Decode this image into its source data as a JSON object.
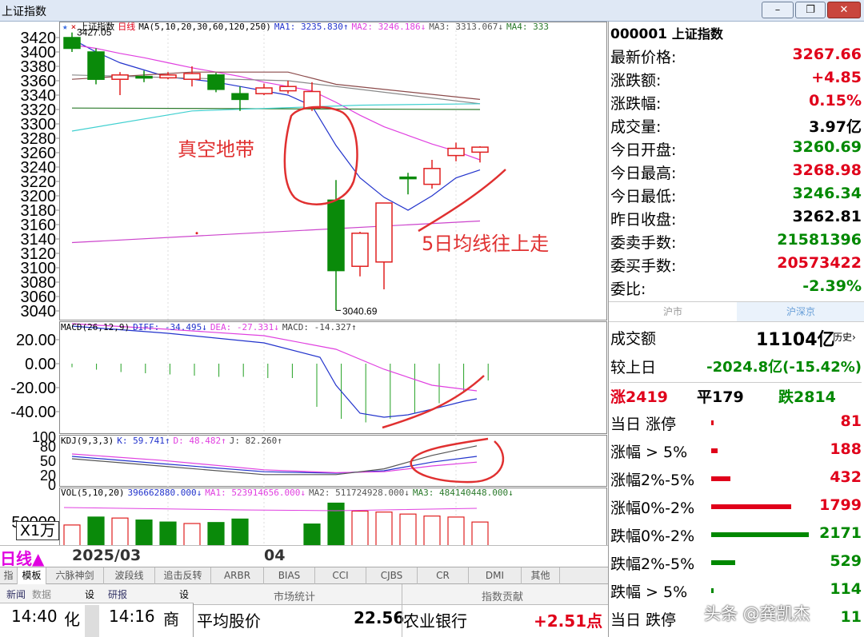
{
  "window": {
    "title": "上证指数",
    "buttons": [
      "–",
      "❐",
      "✕"
    ]
  },
  "chart": {
    "legend_main": {
      "name": "上证指数",
      "period": "日线",
      "ma_params": "MA(5,10,20,30,60,120,250)",
      "ma1": "MA1: 3235.830↑",
      "ma2": "MA2: 3246.186↓",
      "ma3": "MA3: 3313.067↓",
      "ma4": "MA4: 333"
    },
    "high_label": "3427.05",
    "low_label": "3040.69",
    "price_ticks": [
      "3420",
      "3400",
      "3380",
      "3360",
      "3340",
      "3320",
      "3300",
      "3280",
      "3260",
      "3240",
      "3220",
      "3200",
      "3180",
      "3160",
      "3140",
      "3120",
      "3100",
      "3080",
      "3060",
      "3040"
    ],
    "annotation_vacuum": "真空地带",
    "annotation_ma5": "5日均线往上走",
    "macd_legend": {
      "name": "MACD(26,12,9)",
      "diff": "DIFF: -34.495↓",
      "dea": "DEA: -27.331↓",
      "macd": "MACD: -14.327↑"
    },
    "macd_ticks": [
      "20.00",
      "0.00",
      "-20.00",
      "-40.00"
    ],
    "kdj_legend": {
      "name": "KDJ(9,3,3)",
      "k": "K: 59.741↑",
      "d": "D: 48.482↑",
      "j": "J: 82.260↑"
    },
    "kdj_ticks": [
      "100",
      "80",
      "50",
      "20",
      "0"
    ],
    "vol_legend": {
      "name": "VOL(5,10,20)",
      "vol": "396662880.000↓",
      "ma1": "MA1: 523914656.000↓",
      "ma2": "MA2: 511724928.000↓",
      "ma3": "MA3: 484140448.000↓"
    },
    "vol_tick": "50000",
    "vol_unit": "X1万",
    "period_label": "日线▲",
    "date_label_1": "2025/03",
    "date_label_2": "04"
  },
  "chart_data": {
    "type": "candlestick",
    "candles": [
      {
        "o": 3405,
        "c": 3420,
        "h": 3427.05,
        "l": 3400,
        "up": false
      },
      {
        "o": 3400,
        "c": 3362,
        "h": 3405,
        "l": 3355,
        "up": false
      },
      {
        "o": 3362,
        "c": 3368,
        "h": 3372,
        "l": 3340,
        "up": true
      },
      {
        "o": 3366,
        "c": 3366,
        "h": 3374,
        "l": 3358,
        "up": false
      },
      {
        "o": 3364,
        "c": 3368,
        "h": 3372,
        "l": 3362,
        "up": true
      },
      {
        "o": 3362,
        "c": 3370,
        "h": 3380,
        "l": 3352,
        "up": true
      },
      {
        "o": 3368,
        "c": 3348,
        "h": 3371,
        "l": 3344,
        "up": false
      },
      {
        "o": 3342,
        "c": 3334,
        "h": 3352,
        "l": 3318,
        "up": false
      },
      {
        "o": 3342,
        "c": 3350,
        "h": 3356,
        "l": 3340,
        "up": true
      },
      {
        "o": 3346,
        "c": 3352,
        "h": 3360,
        "l": 3342,
        "up": true
      },
      {
        "o": 3322,
        "c": 3345,
        "h": 3358,
        "l": 3318,
        "up": true
      },
      {
        "o": 3194,
        "c": 3096,
        "h": 3222,
        "l": 3040.69,
        "up": false
      },
      {
        "o": 3102,
        "c": 3148,
        "h": 3150,
        "l": 3088,
        "up": true
      },
      {
        "o": 3108,
        "c": 3190,
        "h": 3190,
        "l": 3070,
        "up": true
      },
      {
        "o": 3226,
        "c": 3224,
        "h": 3232,
        "l": 3202,
        "up": false
      },
      {
        "o": 3216,
        "c": 3238,
        "h": 3250,
        "l": 3210,
        "up": true
      },
      {
        "o": 3256,
        "c": 3266,
        "h": 3274,
        "l": 3248,
        "up": true
      },
      {
        "o": 3260.69,
        "c": 3267.66,
        "h": 3268.98,
        "l": 3246.34,
        "up": true
      }
    ],
    "macd_hist": [
      -3,
      -5,
      -7,
      -8,
      -9,
      -10,
      -11,
      -11,
      -12,
      -12,
      -36,
      -46,
      -49,
      -46,
      -41,
      -33,
      -24,
      -14
    ],
    "volume": [
      42000,
      58000,
      56000,
      52000,
      48000,
      45000,
      47000,
      54000,
      0,
      0,
      44000,
      86000,
      70000,
      68000,
      64000,
      60000,
      58000,
      48000
    ],
    "volume_up": [
      true,
      false,
      true,
      false,
      false,
      true,
      false,
      false,
      true,
      true,
      false,
      false,
      true,
      true,
      true,
      true,
      true,
      true
    ]
  },
  "quote": {
    "code": "000001",
    "name": "上证指数",
    "rows": [
      {
        "label": "最新价格:",
        "value": "3267.66",
        "color": "#e0001a"
      },
      {
        "label": "涨跌额:",
        "value": "+4.85",
        "color": "#e0001a"
      },
      {
        "label": "涨跌幅:",
        "value": "0.15%",
        "color": "#e0001a"
      },
      {
        "label": "成交量:",
        "value": "3.97亿",
        "color": "#000000"
      },
      {
        "label": "今日开盘:",
        "value": "3260.69",
        "color": "#008800"
      },
      {
        "label": "今日最高:",
        "value": "3268.98",
        "color": "#e0001a"
      },
      {
        "label": "今日最低:",
        "value": "3246.34",
        "color": "#008800"
      },
      {
        "label": "昨日收盘:",
        "value": "3262.81",
        "color": "#000000"
      },
      {
        "label": "委卖手数:",
        "value": "21581396",
        "color": "#008800"
      },
      {
        "label": "委买手数:",
        "value": "20573422",
        "color": "#e0001a"
      },
      {
        "label": "委比:",
        "value": "-2.39%",
        "color": "#008800"
      }
    ]
  },
  "market_tabs": [
    "沪市",
    "沪深京"
  ],
  "market": {
    "turnover_label": "成交额",
    "turnover_value": "11104亿",
    "history_link": "历史›",
    "compare_label": "较上日",
    "compare_value": "-2024.8亿(-15.42%)",
    "up_label": "涨",
    "up_count": "2419",
    "flat_label": "平",
    "flat_count": "179",
    "down_label": "跌",
    "down_count": "2814",
    "rows": [
      {
        "label": "当日 涨停",
        "value": "81",
        "color": "#e0001a",
        "bar": 3
      },
      {
        "label": "涨幅 > 5%",
        "value": "188",
        "color": "#e0001a",
        "bar": 8
      },
      {
        "label": "涨幅2%-5%",
        "value": "432",
        "color": "#e0001a",
        "bar": 24
      },
      {
        "label": "涨幅0%-2%",
        "value": "1799",
        "color": "#e0001a",
        "bar": 100
      },
      {
        "label": "跌幅0%-2%",
        "value": "2171",
        "color": "#008800",
        "bar": 122
      },
      {
        "label": "跌幅2%-5%",
        "value": "529",
        "color": "#008800",
        "bar": 30
      },
      {
        "label": "跌幅 > 5%",
        "value": "114",
        "color": "#008800",
        "bar": 3
      },
      {
        "label": "当日 跌停",
        "value": "11",
        "color": "#008800",
        "bar": 0
      }
    ]
  },
  "indicator_tabs": [
    "指标",
    "模板",
    "六脉神剑",
    "波段线",
    "追击反转",
    "ARBR",
    "BIAS",
    "CCI",
    "CJBS",
    "CR",
    "DMI",
    "其他"
  ],
  "bottom": {
    "news_tabs": [
      "新闻",
      "数据",
      "设",
      "研报",
      "设"
    ],
    "time1": "14:40",
    "time1_tag": "化",
    "time2": "14:16",
    "time2_tag": "商",
    "stats_header": "市场统计",
    "contrib_header": "指数贡献",
    "avg_price_label": "平均股价",
    "avg_price_value": "22.56",
    "bank_label": "农业银行",
    "bank_value": "+2.51点"
  },
  "watermark": "头条 @龚凯杰"
}
